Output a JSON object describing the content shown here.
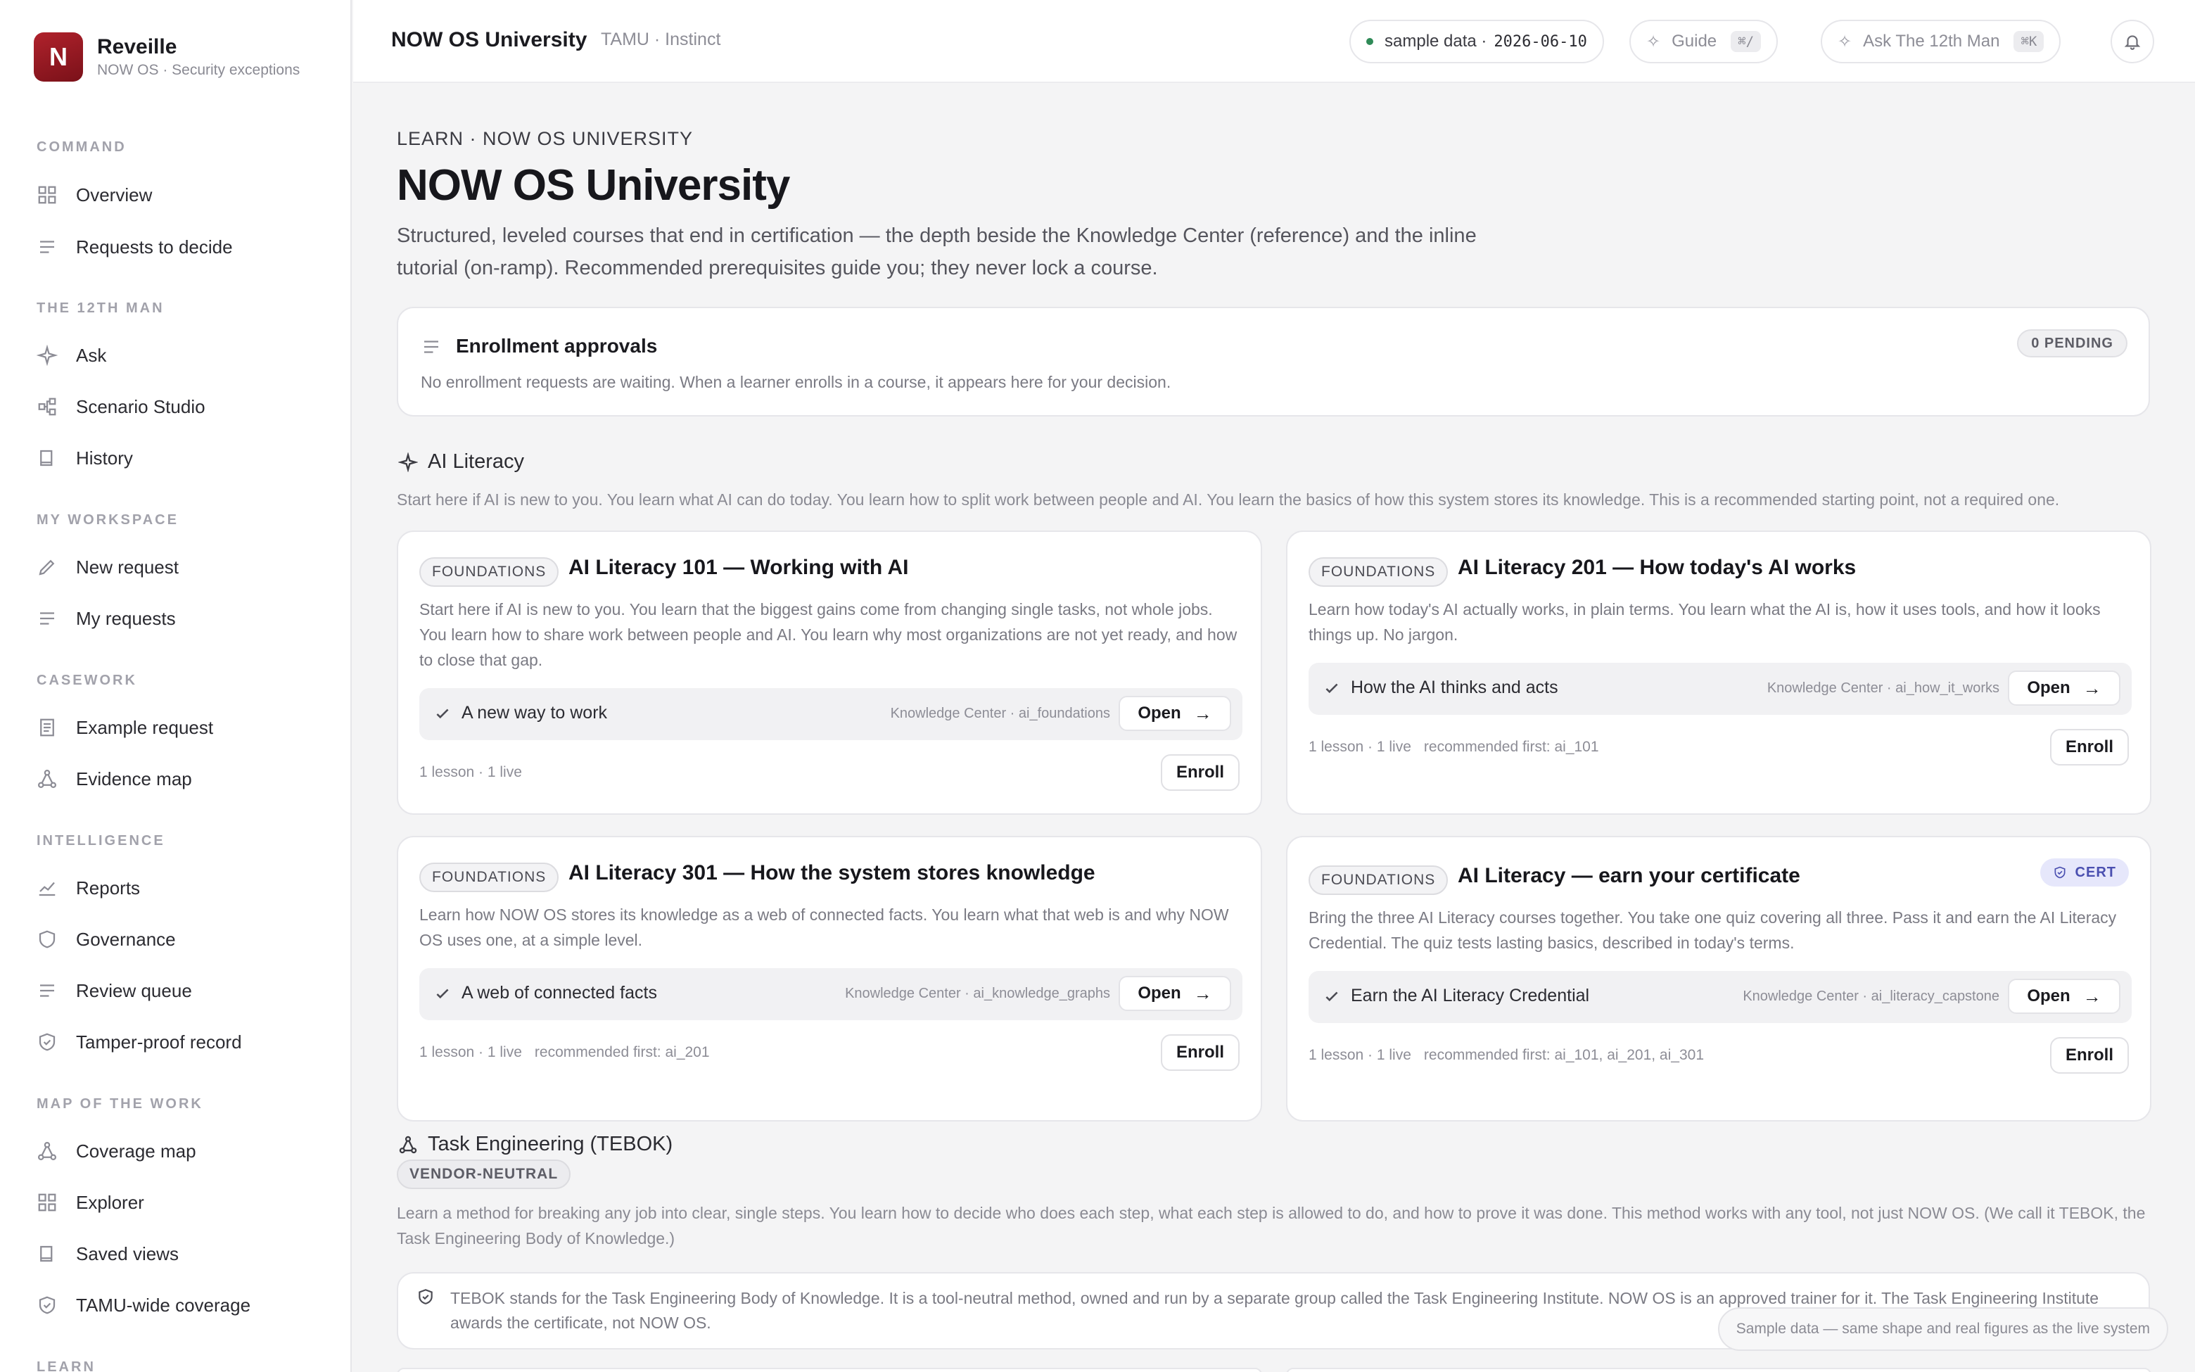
{
  "brand": {
    "logo_letter": "N",
    "name": "Reveille",
    "subtitle": "NOW OS · Security exceptions"
  },
  "sidebar": {
    "sections": [
      {
        "label": "COMMAND",
        "items": [
          {
            "label": "Overview",
            "icon": "grid-icon"
          },
          {
            "label": "Requests to decide",
            "icon": "list-icon"
          }
        ]
      },
      {
        "label": "THE 12TH MAN",
        "items": [
          {
            "label": "Ask",
            "icon": "sparkle-icon"
          },
          {
            "label": "Scenario Studio",
            "icon": "nodes-icon"
          },
          {
            "label": "History",
            "icon": "book-icon"
          }
        ]
      },
      {
        "label": "MY WORKSPACE",
        "items": [
          {
            "label": "New request",
            "icon": "pencil-icon"
          },
          {
            "label": "My requests",
            "icon": "list-icon"
          }
        ]
      },
      {
        "label": "CASEWORK",
        "items": [
          {
            "label": "Example request",
            "icon": "document-icon"
          },
          {
            "label": "Evidence map",
            "icon": "graph-icon"
          }
        ]
      },
      {
        "label": "INTELLIGENCE",
        "items": [
          {
            "label": "Reports",
            "icon": "chart-icon"
          },
          {
            "label": "Governance",
            "icon": "shield-icon"
          },
          {
            "label": "Review queue",
            "icon": "list-icon"
          },
          {
            "label": "Tamper-proof record",
            "icon": "shield-check-icon"
          }
        ]
      },
      {
        "label": "MAP OF THE WORK",
        "items": [
          {
            "label": "Coverage map",
            "icon": "graph-icon"
          },
          {
            "label": "Explorer",
            "icon": "grid-icon"
          },
          {
            "label": "Saved views",
            "icon": "book-icon"
          },
          {
            "label": "TAMU-wide coverage",
            "icon": "shield-check-icon"
          }
        ]
      },
      {
        "label": "LEARN",
        "items": []
      }
    ]
  },
  "topbar": {
    "title": "NOW OS University",
    "subtitle": "TAMU · Instinct",
    "sample_label": "sample data ·",
    "sample_date": "2026-06-10",
    "guide_label": "Guide",
    "guide_kbd": "⌘/",
    "ask_label": "Ask The 12th Man",
    "ask_kbd": "⌘K"
  },
  "page": {
    "eyebrow": "LEARN · NOW OS UNIVERSITY",
    "title": "NOW OS University",
    "lede": "Structured, leveled courses that end in certification — the depth beside the Knowledge Center (reference) and the inline tutorial (on-ramp). Recommended prerequisites guide you; they never lock a course."
  },
  "approvals": {
    "title": "Enrollment approvals",
    "badge": "0 PENDING",
    "description": "No enrollment requests are waiting. When a learner enrolls in a course, it appears here for your decision."
  },
  "ai_literacy": {
    "title": "AI Literacy",
    "description": "Start here if AI is new to you. You learn what AI can do today. You learn how to split work between people and AI. You learn the basics of how this system stores its knowledge. This is a recommended starting point, not a required one.",
    "courses": [
      {
        "tag": "FOUNDATIONS",
        "title": "AI Literacy 101 — Working with AI",
        "description": "Start here if AI is new to you. You learn that the biggest gains come from changing single tasks, not whole jobs. You learn how to share work between people and AI. You learn why most organizations are not yet ready, and how to close that gap.",
        "lesson": "A new way to work",
        "source": "Knowledge Center · ai_foundations",
        "open": "Open",
        "meta": "1 lesson · 1 live",
        "recommended": "",
        "enroll": "Enroll"
      },
      {
        "tag": "FOUNDATIONS",
        "title": "AI Literacy 201 — How today's AI works",
        "description": "Learn how today's AI actually works, in plain terms. You learn what the AI is, how it uses tools, and how it looks things up. No jargon.",
        "lesson": "How the AI thinks and acts",
        "source": "Knowledge Center · ai_how_it_works",
        "open": "Open",
        "meta": "1 lesson · 1 live",
        "recommended": "recommended first: ai_101",
        "enroll": "Enroll"
      },
      {
        "tag": "FOUNDATIONS",
        "title": "AI Literacy 301 — How the system stores knowledge",
        "description": "Learn how NOW OS stores its knowledge as a web of connected facts. You learn what that web is and why NOW OS uses one, at a simple level.",
        "lesson": "A web of connected facts",
        "source": "Knowledge Center · ai_knowledge_graphs",
        "open": "Open",
        "meta": "1 lesson · 1 live",
        "recommended": "recommended first: ai_201",
        "enroll": "Enroll"
      },
      {
        "tag": "FOUNDATIONS",
        "title": "AI Literacy — earn your certificate",
        "badge": "CERT",
        "description": "Bring the three AI Literacy courses together. You take one quiz covering all three. Pass it and earn the AI Literacy Credential. The quiz tests lasting basics, described in today's terms.",
        "lesson": "Earn the AI Literacy Credential",
        "source": "Knowledge Center · ai_literacy_capstone",
        "open": "Open",
        "meta": "1 lesson · 1 live",
        "recommended": "recommended first: ai_101, ai_201, ai_301",
        "enroll": "Enroll"
      }
    ]
  },
  "tebok": {
    "title": "Task Engineering (TEBOK)",
    "badge": "VENDOR-NEUTRAL",
    "description": "Learn a method for breaking any job into clear, single steps. You learn how to decide who does each step, what each step is allowed to do, and how to prove it was done. This method works with any tool, not just NOW OS. (We call it TEBOK, the Task Engineering Body of Knowledge.)",
    "note": "TEBOK stands for the Task Engineering Body of Knowledge. It is a tool-neutral method, owned and run by a separate group called the Task Engineering Institute. NOW OS is an approved trainer for it. The Task Engineering Institute awards the certificate, not NOW OS."
  },
  "toast": "Sample data — same shape and real figures as the live system"
}
